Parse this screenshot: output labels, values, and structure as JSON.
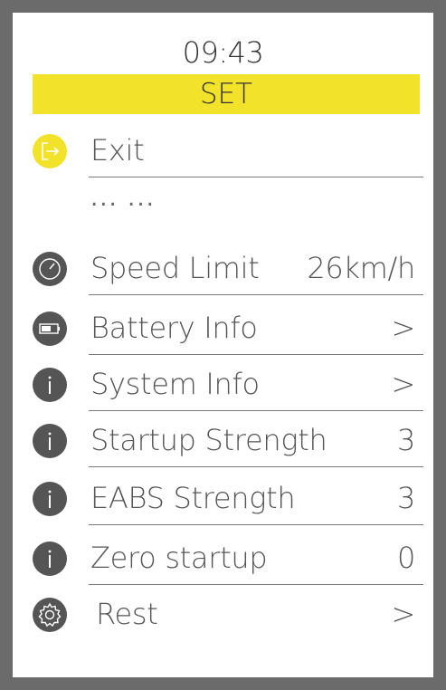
{
  "status": {
    "time": "09:43"
  },
  "header": {
    "title": "SET"
  },
  "placeholder_row": {
    "text": "... ..."
  },
  "menu": {
    "exit": {
      "label": "Exit"
    },
    "speed_limit": {
      "label": "Speed Limit",
      "value": "26km/h"
    },
    "battery_info": {
      "label": "Battery Info",
      "value": ">"
    },
    "system_info": {
      "label": "System Info",
      "value": ">"
    },
    "startup_strength": {
      "label": "Startup Strength",
      "value": "3"
    },
    "eabs_strength": {
      "label": "EABS Strength",
      "value": "3"
    },
    "zero_startup": {
      "label": "Zero startup",
      "value": "0"
    },
    "rest": {
      "label": "Rest",
      "value": ">"
    }
  },
  "colors": {
    "accent": "#f2e32a",
    "icon_dark": "#555555",
    "frame": "#6b6b6b"
  },
  "icons": {
    "exit": "exit-icon",
    "speed_limit": "speedometer-icon",
    "battery_info": "battery-icon",
    "system_info": "info-icon",
    "rest": "gear-icon"
  }
}
